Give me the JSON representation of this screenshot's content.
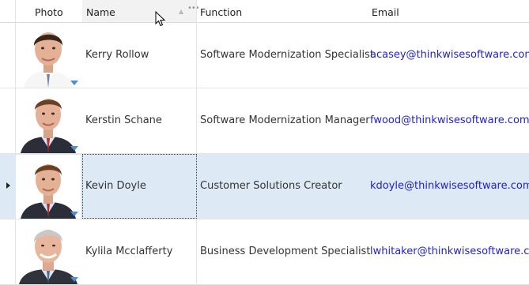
{
  "columns": {
    "photo": "Photo",
    "name": "Name",
    "function": "Function",
    "email": "Email"
  },
  "rows": [
    {
      "name": "Kerry Rollow",
      "function": "Software Modernization Specialist",
      "email": "acasey@thinkwisesoftware.com",
      "avatar": "young man with dark hair, white shirt, tie",
      "selected": false
    },
    {
      "name": "Kerstin Schane",
      "function": "Software Modernization Manager",
      "email": "fwood@thinkwisesoftware.com",
      "avatar": "young man with brown hair, dark suit, red tie",
      "selected": false
    },
    {
      "name": "Kevin Doyle",
      "function": "Customer Solutions Creator",
      "email": "kdoyle@thinkwisesoftware.com",
      "avatar": "young man with brown hair, dark suit, red tie",
      "selected": true
    },
    {
      "name": "Kylila Mcclafferty",
      "function": "Business Development Specialist",
      "email": "lwhitaker@thinkwisesoftware.com",
      "avatar": "older man with grey hair, dark suit",
      "selected": false
    }
  ],
  "icons": {
    "sort": "sort-up-icon",
    "column_menu": "more-horizontal-icon",
    "row_indicator": "row-indicator-icon",
    "cursor": "mouse-pointer-icon"
  },
  "colors": {
    "selection": "#ddeaf6",
    "email_link": "#2222cc",
    "header_sorted": "#f2f2f2"
  }
}
